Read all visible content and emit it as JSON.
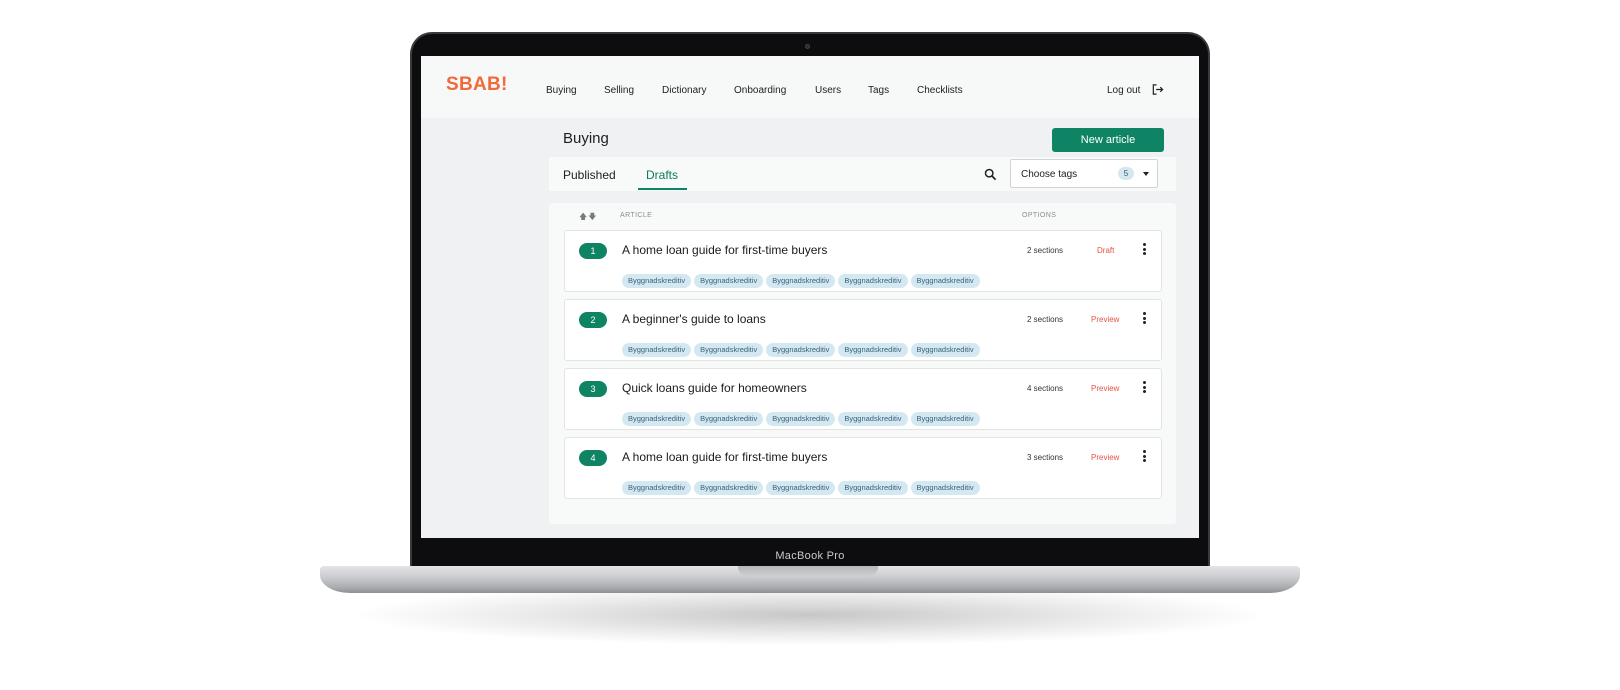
{
  "device": {
    "label": "MacBook Pro"
  },
  "brand": {
    "logo": "SBAB!",
    "accent": "#f06a3c",
    "primary": "#0f8464",
    "status_color": "#e25546"
  },
  "nav": {
    "items": [
      "Buying",
      "Selling",
      "Dictionary",
      "Onboarding",
      "Users",
      "Tags",
      "Checklists"
    ],
    "logout_label": "Log out"
  },
  "page": {
    "title": "Buying",
    "new_article_label": "New article"
  },
  "tabs": {
    "published": "Published",
    "drafts": "Drafts",
    "active": "drafts"
  },
  "filter": {
    "label": "Choose tags",
    "count": "5"
  },
  "table": {
    "col_article": "ARTICLE",
    "col_options": "OPTIONS",
    "rows": [
      {
        "num": "1",
        "title": "A home loan guide for first-time buyers",
        "sections": "2 sections",
        "status": "Draft",
        "tags": [
          "Byggnadskreditiv",
          "Byggnadskreditiv",
          "Byggnadskreditiv",
          "Byggnadskreditiv",
          "Byggnadskreditiv"
        ]
      },
      {
        "num": "2",
        "title": "A beginner's guide to loans",
        "sections": "2 sections",
        "status": "Preview",
        "tags": [
          "Byggnadskreditiv",
          "Byggnadskreditiv",
          "Byggnadskreditiv",
          "Byggnadskreditiv",
          "Byggnadskreditiv"
        ]
      },
      {
        "num": "3",
        "title": "Quick loans guide for homeowners",
        "sections": "4 sections",
        "status": "Preview",
        "tags": [
          "Byggnadskreditiv",
          "Byggnadskreditiv",
          "Byggnadskreditiv",
          "Byggnadskreditiv",
          "Byggnadskreditiv"
        ]
      },
      {
        "num": "4",
        "title": "A home loan guide for first-time buyers",
        "sections": "3 sections",
        "status": "Preview",
        "tags": [
          "Byggnadskreditiv",
          "Byggnadskreditiv",
          "Byggnadskreditiv",
          "Byggnadskreditiv",
          "Byggnadskreditiv"
        ]
      }
    ]
  }
}
